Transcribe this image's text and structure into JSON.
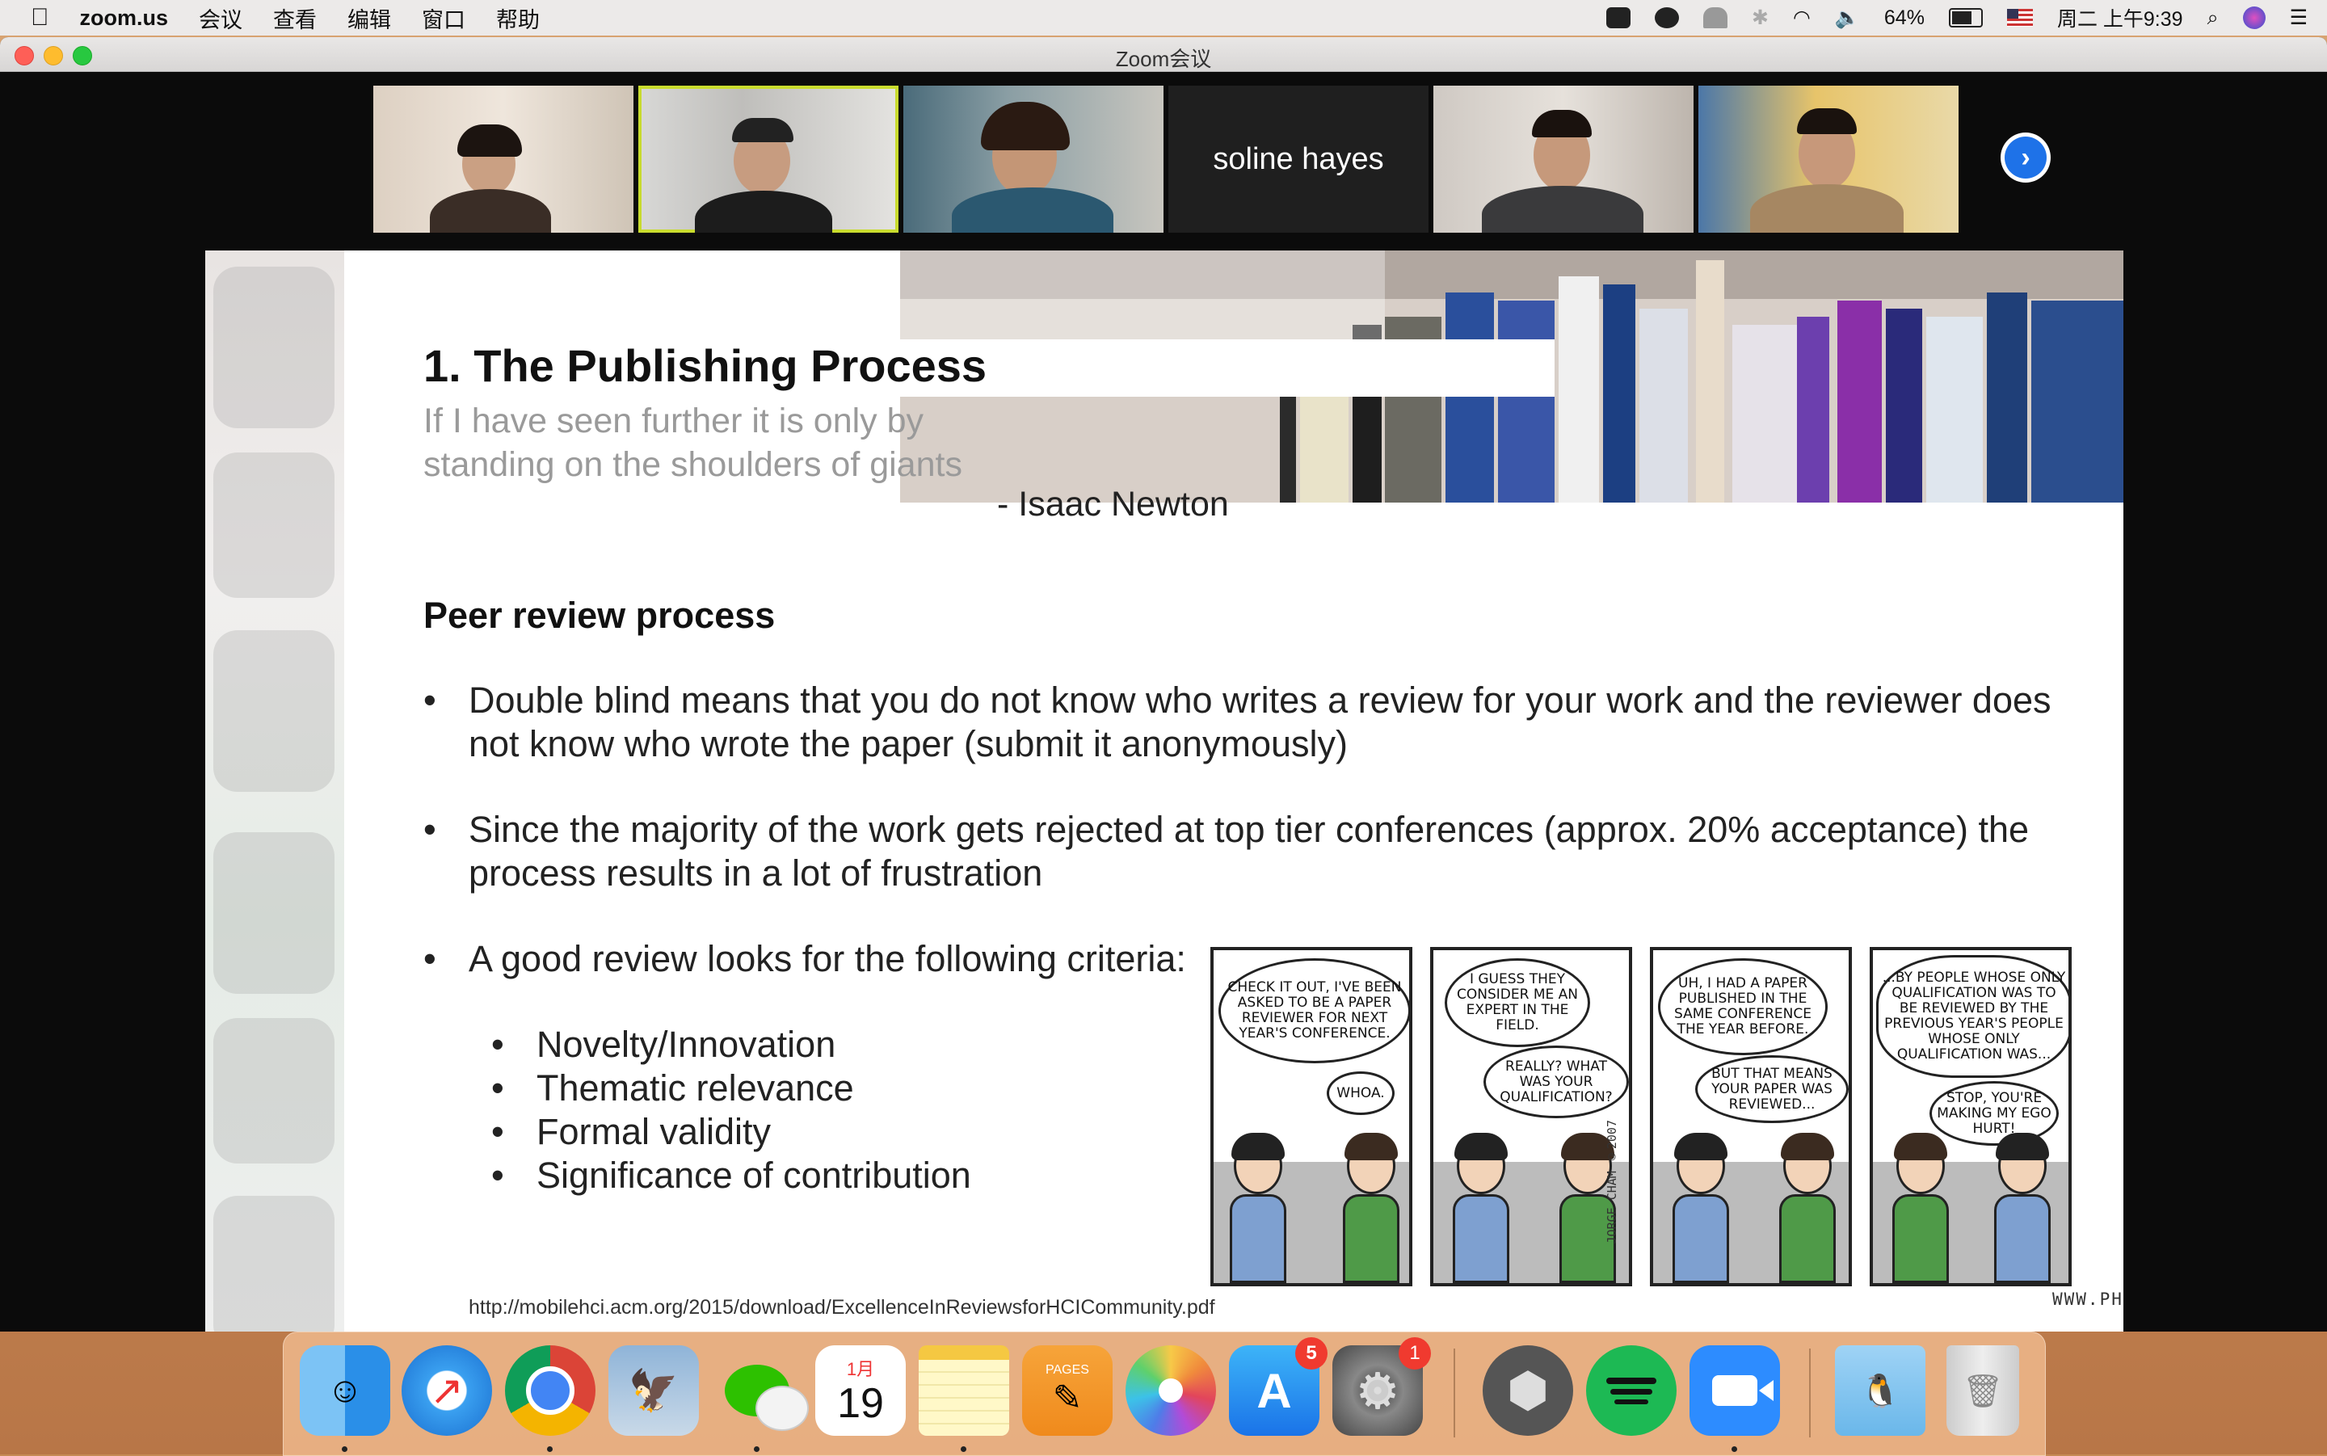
{
  "menubar": {
    "app_name": "zoom.us",
    "menus": [
      "会议",
      "查看",
      "编辑",
      "窗口",
      "帮助"
    ],
    "battery_percent": "64%",
    "clock": "周二 上午9:39"
  },
  "window": {
    "title": "Zoom会议"
  },
  "participants": {
    "name_only_tile": "soline hayes",
    "next_label": "›"
  },
  "slide": {
    "title": "1. The Publishing Process",
    "quote_line1": "If I have seen further it is only by",
    "quote_line2": "standing on the shoulders of giants",
    "author": "- Isaac Newton",
    "subheading": "Peer review process",
    "bullet1_line1": "Double blind means that you do not know who writes a review for your work and the reviewer does",
    "bullet1_line2": "not know who wrote the paper (submit it anonymously)",
    "bullet2_line1": "Since the majority of the work gets rejected at top tier conferences (approx. 20% acceptance) the",
    "bullet2_line2": "process results in a lot of frustration",
    "bullet3": "A good review looks for the following criteria:",
    "criteria": [
      "Novelty/Innovation",
      "Thematic relevance",
      "Formal validity",
      "Significance of contribution"
    ],
    "url": "http://mobilehci.acm.org/2015/download/ExcellenceInReviewsforHCICommunity.pdf",
    "bullet_char": "•"
  },
  "comic": {
    "p1_a": "CHECK IT OUT, I'VE BEEN ASKED TO BE A PAPER REVIEWER FOR NEXT YEAR'S CONFERENCE.",
    "p1_b": "WHOA.",
    "p2_a": "I GUESS THEY CONSIDER ME AN EXPERT IN THE FIELD.",
    "p2_b": "REALLY? WHAT WAS YOUR QUALIFICATION?",
    "p3_a": "UH, I HAD A PAPER PUBLISHED IN THE SAME CONFERENCE THE YEAR BEFORE.",
    "p3_b": "BUT THAT MEANS YOUR PAPER WAS REVIEWED...",
    "p4_a": "...BY PEOPLE WHOSE ONLY QUALIFICATION WAS TO BE REVIEWED BY THE PREVIOUS YEAR'S PEOPLE WHOSE ONLY QUALIFICATION WAS...",
    "p4_b": "STOP, YOU'RE MAKING MY EGO HURT!",
    "signature": "JORGE CHAM ©2007",
    "credit": "WWW.PHDCOMICS.COM"
  },
  "dock": {
    "calendar_month": "1月",
    "calendar_day": "19",
    "appstore_badge": "5",
    "settings_badge": "1",
    "pages_label": "PAGES"
  }
}
